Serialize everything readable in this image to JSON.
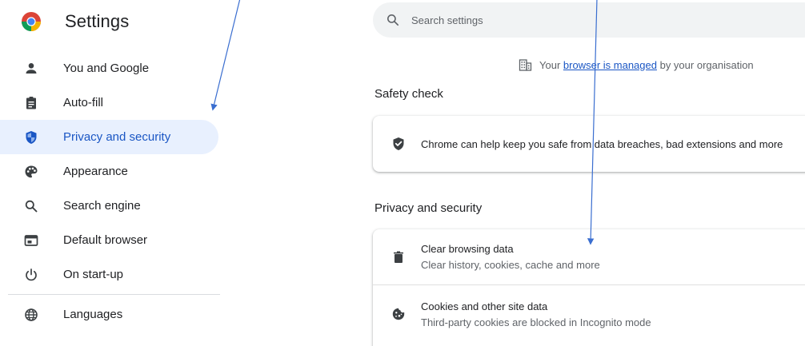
{
  "sidebar": {
    "title": "Settings",
    "items": [
      {
        "label": "You and Google",
        "icon": "person-icon",
        "active": false
      },
      {
        "label": "Auto-fill",
        "icon": "clipboard-icon",
        "active": false
      },
      {
        "label": "Privacy and security",
        "icon": "shield-icon",
        "active": true
      },
      {
        "label": "Appearance",
        "icon": "palette-icon",
        "active": false
      },
      {
        "label": "Search engine",
        "icon": "search-icon",
        "active": false
      },
      {
        "label": "Default browser",
        "icon": "browser-window-icon",
        "active": false
      },
      {
        "label": "On start-up",
        "icon": "power-icon",
        "active": false
      },
      {
        "label": "Languages",
        "icon": "globe-icon",
        "active": false
      }
    ]
  },
  "search": {
    "placeholder": "Search settings"
  },
  "managed_notice": {
    "prefix": "Your ",
    "link": "browser is managed",
    "suffix": " by your organisation"
  },
  "safety_check": {
    "title": "Safety check",
    "row_text": "Chrome can help keep you safe from data breaches, bad extensions and more"
  },
  "privacy": {
    "title": "Privacy and security",
    "rows": [
      {
        "title": "Clear browsing data",
        "subtitle": "Clear history, cookies, cache and more",
        "icon": "trash-icon"
      },
      {
        "title": "Cookies and other site data",
        "subtitle": "Third-party cookies are blocked in Incognito mode",
        "icon": "cookie-icon"
      }
    ]
  },
  "colors": {
    "accent": "#1a56c4",
    "active_bg": "#e8f0fe",
    "annotation_arrow": "#3a6ed0"
  }
}
